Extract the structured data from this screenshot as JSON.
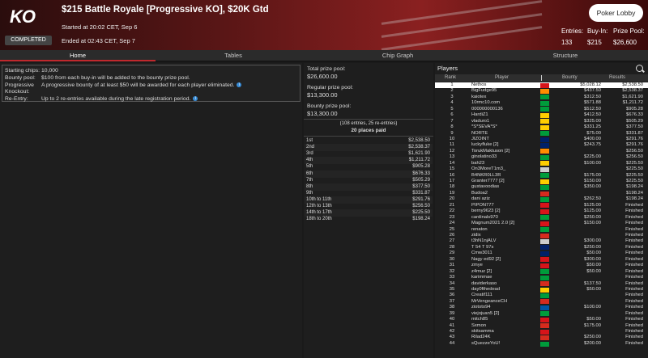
{
  "header": {
    "logo_text": "KO",
    "badge": "COMPLETED",
    "title": "$215 Battle Royale [Progressive KO], $20K Gtd",
    "started": "Started at 20:02 CET, Sep 6",
    "ended": "Ended at 02:43 CET, Sep 7",
    "lobby_button": "Poker Lobby",
    "entries_label": "Entries:",
    "entries_value": "133",
    "buyin_label": "Buy-In:",
    "buyin_value": "$215",
    "prizepool_label": "Prize Pool:",
    "prizepool_value": "$26,600"
  },
  "tabs": [
    "Home",
    "Tables",
    "Chip Graph",
    "Structure"
  ],
  "info": {
    "rows": [
      {
        "k": "Starting chips:",
        "v": "10,000",
        "i": false
      },
      {
        "k": "Bounty pool:",
        "v": "$100 from each buy-in will be added to the bounty prize pool.",
        "i": false
      },
      {
        "k": "Progressive",
        "v": "A progressive bounty of at least $50 will be awarded for each player eliminated.",
        "i": true
      },
      {
        "k": "Knockout:",
        "v": "",
        "i": false
      },
      {
        "k": "Re-Entry:",
        "v": "Up to 2 re-entries available during the late registration period.",
        "i": true
      }
    ]
  },
  "pools": [
    {
      "label": "Total prize pool:",
      "value": "$26,600.00"
    },
    {
      "label": "Regular prize pool:",
      "value": "$13,300.00"
    },
    {
      "label": "Bounty prize pool:",
      "value": "$13,300.00"
    }
  ],
  "entries_note": "(108 entries, 25 re-entries)",
  "places_paid": "20 places paid",
  "prizes": [
    [
      "1st",
      "$2,538.50"
    ],
    [
      "2nd",
      "$2,538.37"
    ],
    [
      "3rd",
      "$1,621.90"
    ],
    [
      "4th",
      "$1,211.72"
    ],
    [
      "5th",
      "$905.28"
    ],
    [
      "6th",
      "$676.33"
    ],
    [
      "7th",
      "$505.29"
    ],
    [
      "8th",
      "$377.50"
    ],
    [
      "9th",
      "$331.87"
    ],
    [
      "10th to 11th",
      "$291.76"
    ],
    [
      "12th to 13th",
      "$256.50"
    ],
    [
      "14th to 17th",
      "$225.50"
    ],
    [
      "18th to 20th",
      "$198.24"
    ]
  ],
  "players": {
    "title": "Players",
    "headers": {
      "rank": "Rank",
      "player": "Player",
      "bounty": "Bounty",
      "results": "Results"
    },
    "colors": {
      "selected_bg": "#ffffff",
      "accent": "#c0282d"
    },
    "rows": [
      [
        "1",
        "Nethos",
        "$5,028.12",
        "$2,538.50",
        "#d7141a"
      ],
      [
        "2",
        "BigFudge95",
        "$437.50",
        "$2,538.37",
        "#ff8c00"
      ],
      [
        "3",
        "kaiotex",
        "$312.50",
        "$1,621.90",
        "#009c3b"
      ],
      [
        "4",
        "10rmc10.com",
        "$571.88",
        "$1,211.72",
        "#009c3b"
      ],
      [
        "5",
        "000000000136",
        "$512.50",
        "$905.28",
        "#009c3b"
      ],
      [
        "6",
        "HardiZ1",
        "$412.50",
        "$676.33",
        "#ffce00"
      ],
      [
        "7",
        "vladuro1",
        "$325.00",
        "$505.29",
        "#ffce00"
      ],
      [
        "8",
        "*S*SEVA*S*",
        "$331.25",
        "$377.50",
        "#ffce00"
      ],
      [
        "9",
        "NORTE",
        "$75.00",
        "$331.87",
        "#009c3b"
      ],
      [
        "10",
        "JIZOINT",
        "$400.00",
        "$291.76",
        "#012169"
      ],
      [
        "11",
        "luckyfluke [2]",
        "$243.75",
        "$291.76",
        "#012169"
      ],
      [
        "12",
        "TorukMaktuson [2]",
        "",
        "$256.50",
        "#ff8c00"
      ],
      [
        "13",
        "ginolatino33",
        "$225.00",
        "$256.50",
        "#009c3b"
      ],
      [
        "14",
        "bah23",
        "$100.00",
        "$225.50",
        "#ffce00"
      ],
      [
        "15",
        "On3MoreT1m3_",
        "",
        "$225.50",
        "#cccccc"
      ],
      [
        "16",
        "B4NKR0LL3R",
        "$175.00",
        "$225.50",
        "#009c3b"
      ],
      [
        "17",
        "Granter7777 [2]",
        "$150.00",
        "$225.50",
        "#ffce00"
      ],
      [
        "18",
        "gustavoodias",
        "$350.00",
        "$198.24",
        "#009c3b"
      ],
      [
        "19",
        "Budoa2",
        "",
        "$198.24",
        "#d52b1e"
      ],
      [
        "20",
        "dani aziz",
        "$262.50",
        "$198.24",
        "#009c3b"
      ],
      [
        "21",
        "PIPON777",
        "$125.00",
        "Finished",
        "#d7141a"
      ],
      [
        "22",
        "berny9623 [2]",
        "$125.00",
        "Finished",
        "#d7141a"
      ],
      [
        "23",
        "cardinals970",
        "$250.00",
        "Finished",
        "#009c3b"
      ],
      [
        "24",
        "Magnum2021 2.0 [2]",
        "$150.00",
        "Finished",
        "#d7141a"
      ],
      [
        "25",
        "renaton",
        "",
        "Finished",
        "#009c3b"
      ],
      [
        "26",
        "zidix",
        "",
        "Finished",
        "#d52b1e"
      ],
      [
        "27",
        "t3hN1njALV",
        "$300.00",
        "Finished",
        "#cccccc"
      ],
      [
        "28",
        "T 54 T 97s",
        "$250.00",
        "Finished",
        "#012169"
      ],
      [
        "29",
        "Cmw3011",
        "$50.00",
        "Finished",
        "#012169"
      ],
      [
        "30",
        "Nagy ed92 [2]",
        "$300.00",
        "Finished",
        "#d7141a"
      ],
      [
        "31",
        "zmye",
        "$50.00",
        "Finished",
        "#d7141a"
      ],
      [
        "32",
        "z4muz [2]",
        "$50.00",
        "Finished",
        "#009c3b"
      ],
      [
        "33",
        "karimmae",
        "",
        "Finished",
        "#009c3b"
      ],
      [
        "34",
        "daviderkaso",
        "$137.50",
        "Finished",
        "#d52b1e"
      ],
      [
        "35",
        "day0fthedead",
        "$50.00",
        "Finished",
        "#ffce00"
      ],
      [
        "36",
        "Creatif111",
        "",
        "Finished",
        "#009c3b"
      ],
      [
        "37",
        "MrVengeanceCH",
        "",
        "Finished",
        "#d52b1e"
      ],
      [
        "38",
        "ziototo94",
        "$100.00",
        "Finished",
        "#0055a4"
      ],
      [
        "39",
        "viejojuan5 [2]",
        "",
        "Finished",
        "#009c3b"
      ],
      [
        "40",
        "mitch85",
        "$50.00",
        "Finished",
        "#d7141a"
      ],
      [
        "41",
        "Sxmon",
        "$175.00",
        "Finished",
        "#d52b1e"
      ],
      [
        "42",
        "skitsamma",
        "",
        "Finished",
        "#d7141a"
      ],
      [
        "43",
        "Rilad24K",
        "$250.00",
        "Finished",
        "#d52b1e"
      ],
      [
        "44",
        "sQuezzeYoU!",
        "$200.00",
        "Finished",
        "#009c3b"
      ]
    ]
  }
}
